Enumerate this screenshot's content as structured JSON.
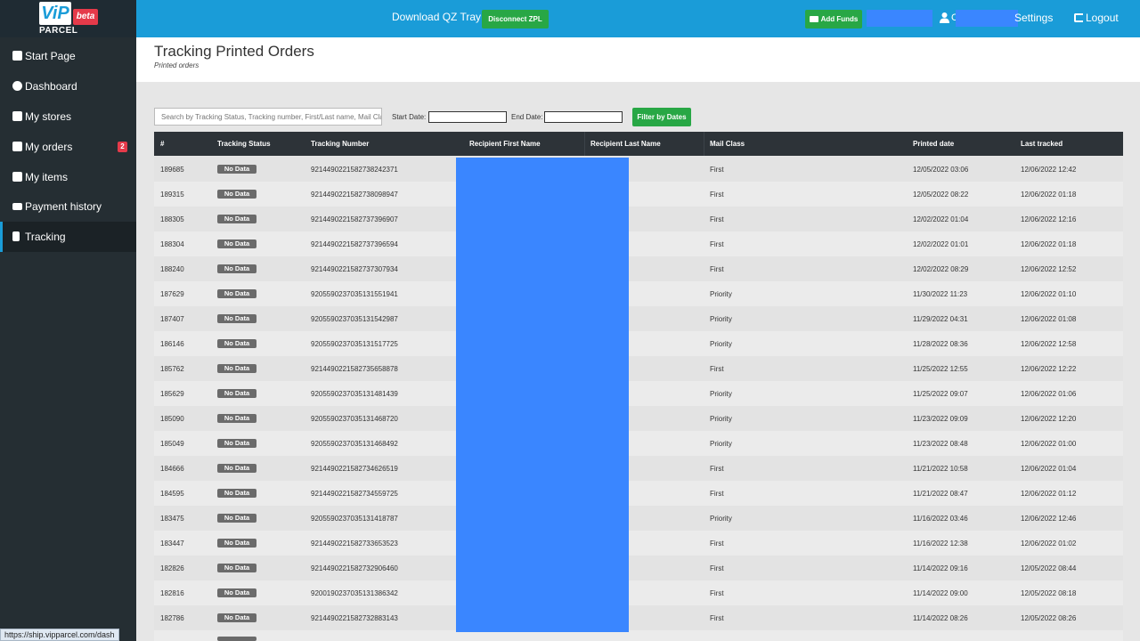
{
  "brand": {
    "logo_text": "ViP",
    "badge": "beta",
    "sub": "PARCEL"
  },
  "topbar": {
    "qz_tray": "Download QZ Tray",
    "disconnect": "Disconnect ZPL",
    "add_funds": "Add Funds",
    "user_partial": "C",
    "settings": "Settings",
    "logout": "Logout"
  },
  "sidebar": {
    "items": [
      {
        "label": "Start Page",
        "icon": "clipboard-icon"
      },
      {
        "label": "Dashboard",
        "icon": "pie-chart-icon"
      },
      {
        "label": "My stores",
        "icon": "store-icon"
      },
      {
        "label": "My orders",
        "icon": "truck-icon",
        "badge": "2"
      },
      {
        "label": "My items",
        "icon": "boxes-icon"
      },
      {
        "label": "Payment history",
        "icon": "credit-card-icon"
      },
      {
        "label": "Tracking",
        "icon": "document-icon",
        "active": true
      }
    ]
  },
  "page": {
    "title": "Tracking Printed Orders",
    "subtitle": "Printed orders"
  },
  "filters": {
    "search_placeholder": "Search by Tracking Status, Tracking number, First/Last name, Mail Class",
    "start_label": "Start Date:",
    "end_label": "End Date:",
    "filter_button": "Filter by Dates"
  },
  "table": {
    "columns": [
      "#",
      "Tracking Status",
      "Tracking Number",
      "Recipient First Name",
      "Recipient Last Name",
      "Mail Class",
      "Printed date",
      "Last tracked"
    ],
    "rows": [
      {
        "id": "189685",
        "status": "No Data",
        "tracking": "9214490221582738242371",
        "mail": "First",
        "printed": "12/05/2022 03:06",
        "tracked": "12/06/2022 12:42"
      },
      {
        "id": "189315",
        "status": "No Data",
        "tracking": "9214490221582738098947",
        "mail": "First",
        "printed": "12/05/2022 08:22",
        "tracked": "12/06/2022 01:18"
      },
      {
        "id": "188305",
        "status": "No Data",
        "tracking": "9214490221582737396907",
        "mail": "First",
        "printed": "12/02/2022 01:04",
        "tracked": "12/06/2022 12:16"
      },
      {
        "id": "188304",
        "status": "No Data",
        "tracking": "9214490221582737396594",
        "mail": "First",
        "printed": "12/02/2022 01:01",
        "tracked": "12/06/2022 01:18"
      },
      {
        "id": "188240",
        "status": "No Data",
        "tracking": "9214490221582737307934",
        "mail": "First",
        "printed": "12/02/2022 08:29",
        "tracked": "12/06/2022 12:52"
      },
      {
        "id": "187629",
        "status": "No Data",
        "tracking": "9205590237035131551941",
        "mail": "Priority",
        "printed": "11/30/2022 11:23",
        "tracked": "12/06/2022 01:10"
      },
      {
        "id": "187407",
        "status": "No Data",
        "tracking": "9205590237035131542987",
        "mail": "Priority",
        "printed": "11/29/2022 04:31",
        "tracked": "12/06/2022 01:08"
      },
      {
        "id": "186146",
        "status": "No Data",
        "tracking": "9205590237035131517725",
        "mail": "Priority",
        "printed": "11/28/2022 08:36",
        "tracked": "12/06/2022 12:58"
      },
      {
        "id": "185762",
        "status": "No Data",
        "tracking": "9214490221582735658878",
        "mail": "First",
        "printed": "11/25/2022 12:55",
        "tracked": "12/06/2022 12:22"
      },
      {
        "id": "185629",
        "status": "No Data",
        "tracking": "9205590237035131481439",
        "mail": "Priority",
        "printed": "11/25/2022 09:07",
        "tracked": "12/06/2022 01:06"
      },
      {
        "id": "185090",
        "status": "No Data",
        "tracking": "9205590237035131468720",
        "mail": "Priority",
        "printed": "11/23/2022 09:09",
        "tracked": "12/06/2022 12:20"
      },
      {
        "id": "185049",
        "status": "No Data",
        "tracking": "9205590237035131468492",
        "mail": "Priority",
        "printed": "11/23/2022 08:48",
        "tracked": "12/06/2022 01:00"
      },
      {
        "id": "184666",
        "status": "No Data",
        "tracking": "9214490221582734626519",
        "mail": "First",
        "printed": "11/21/2022 10:58",
        "tracked": "12/06/2022 01:04"
      },
      {
        "id": "184595",
        "status": "No Data",
        "tracking": "9214490221582734559725",
        "mail": "First",
        "printed": "11/21/2022 08:47",
        "tracked": "12/06/2022 01:12"
      },
      {
        "id": "183475",
        "status": "No Data",
        "tracking": "9205590237035131418787",
        "mail": "Priority",
        "printed": "11/16/2022 03:46",
        "tracked": "12/06/2022 12:46"
      },
      {
        "id": "183447",
        "status": "No Data",
        "tracking": "9214490221582733653523",
        "mail": "First",
        "printed": "11/16/2022 12:38",
        "tracked": "12/06/2022 01:02"
      },
      {
        "id": "182826",
        "status": "No Data",
        "tracking": "9214490221582732906460",
        "mail": "First",
        "printed": "11/14/2022 09:16",
        "tracked": "12/05/2022 08:44"
      },
      {
        "id": "182816",
        "status": "No Data",
        "tracking": "9200190237035131386342",
        "mail": "First",
        "printed": "11/14/2022 09:00",
        "tracked": "12/05/2022 08:18"
      },
      {
        "id": "182786",
        "status": "No Data",
        "tracking": "9214490221582732883143",
        "mail": "First",
        "printed": "11/14/2022 08:26",
        "tracked": "12/05/2022 08:26"
      }
    ]
  },
  "status_bar": {
    "url": "https://ship.vipparcel.com/dash"
  },
  "colors": {
    "topbar": "#1a9cd8",
    "sidebar": "#252e33",
    "green": "#28a745",
    "redaction": "#3a86ff",
    "badge": "#e53a4a"
  }
}
